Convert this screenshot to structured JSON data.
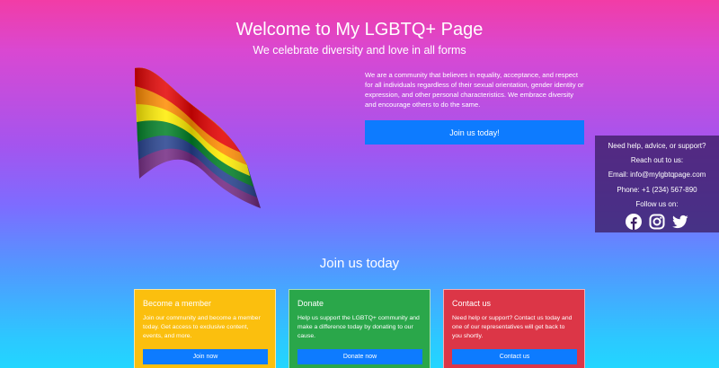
{
  "header": {
    "title": "Welcome to My LGBTQ+ Page",
    "subtitle": "We celebrate diversity and love in all forms"
  },
  "intro": {
    "text": "We are a community that believes in equality, acceptance, and respect for all individuals regardless of their sexual orientation, gender identity or expression, and other personal characteristics. We embrace diversity and encourage others to do the same.",
    "button_label": "Join us today!"
  },
  "help": {
    "line1": "Need help, advice, or support?",
    "line2": "Reach out to us:",
    "email": "Email: info@mylgbtqpage.com",
    "phone": "Phone: +1 (234) 567-890",
    "follow": "Follow us on:",
    "icons": [
      "facebook-icon",
      "instagram-icon",
      "twitter-icon"
    ]
  },
  "join_section": {
    "title": "Join us today",
    "cards": [
      {
        "title": "Become a member",
        "text": "Join our community and become a member today. Get access to exclusive content, events, and more.",
        "button_label": "Join now",
        "color": "#fbbf0e"
      },
      {
        "title": "Donate",
        "text": "Help us support the LGBTQ+ community and make a difference today by donating to our cause.",
        "button_label": "Donate now",
        "color": "#2aa74a"
      },
      {
        "title": "Contact us",
        "text": "Need help or support? Contact us today and one of our representatives will get back to you shortly.",
        "button_label": "Contact us",
        "color": "#dc3647"
      }
    ]
  },
  "colors": {
    "accent_button": "#0d7bff",
    "flag_stripes": [
      "#e40303",
      "#ff8c00",
      "#ffed00",
      "#008026",
      "#24408e",
      "#732982"
    ]
  }
}
